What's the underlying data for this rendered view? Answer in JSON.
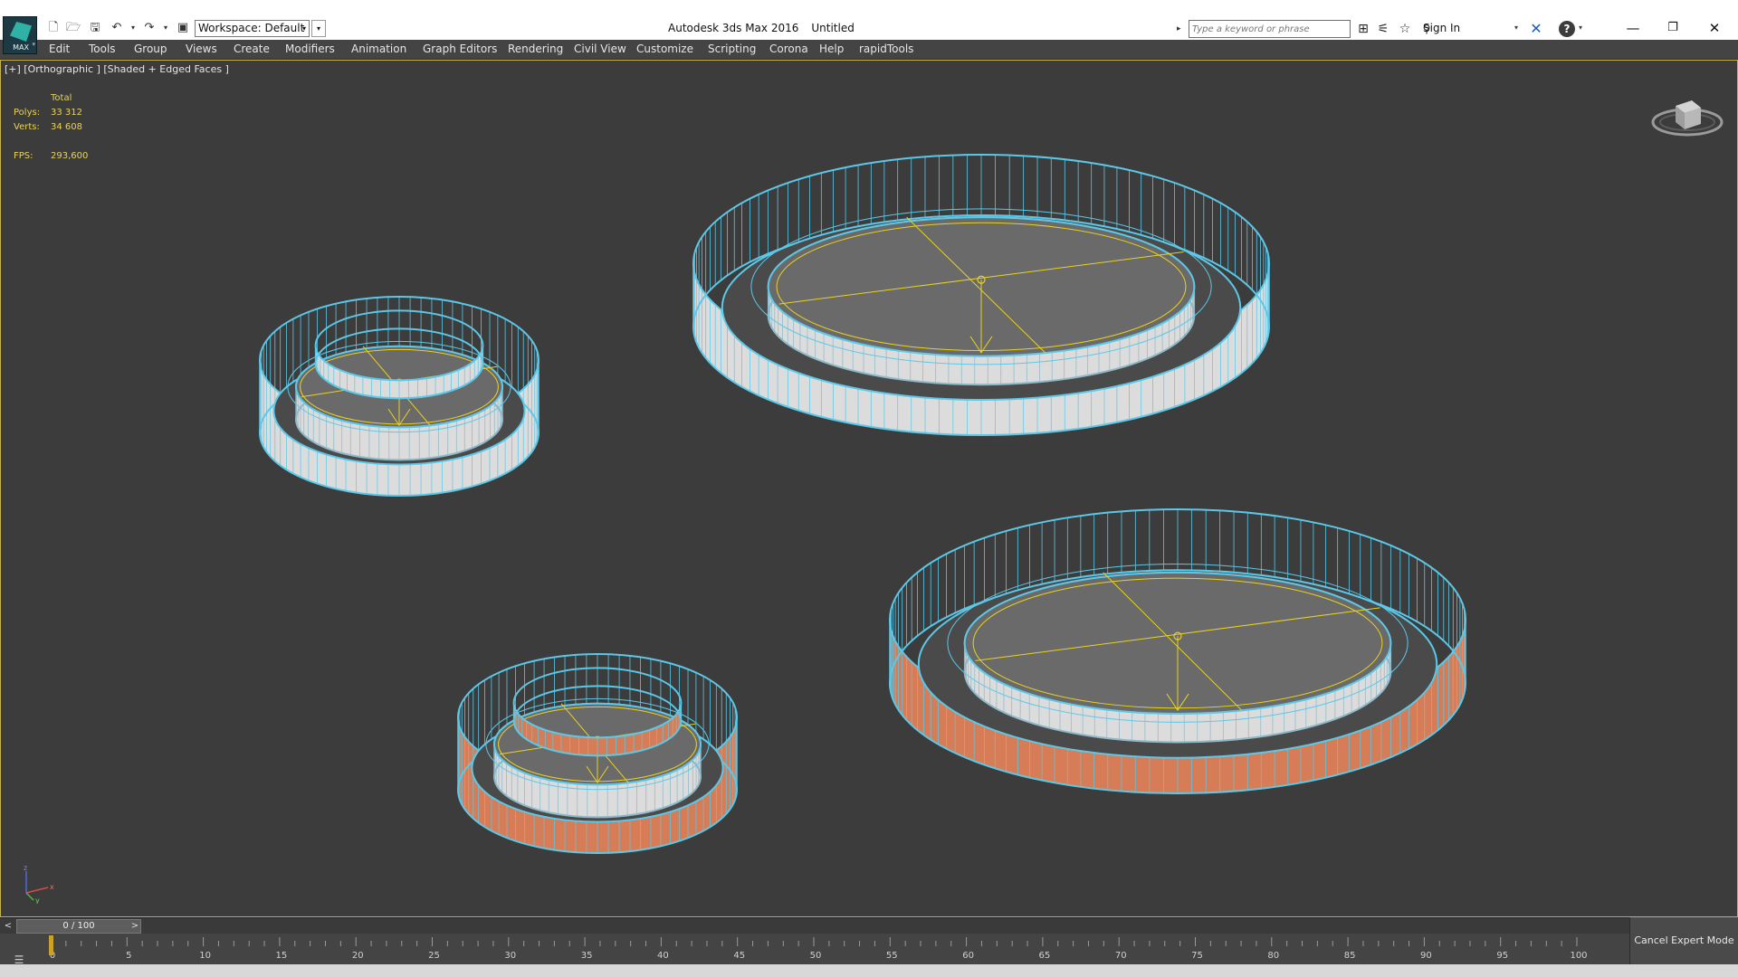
{
  "app": {
    "logo_text": "MAX",
    "title": "Autodesk 3ds Max 2016",
    "document": "Untitled",
    "workspace": "Workspace: Default"
  },
  "search": {
    "placeholder": "Type a keyword or phrase"
  },
  "header": {
    "sign_in": "Sign In"
  },
  "icons": {
    "quick_access": [
      "new-file-icon",
      "open-folder-icon",
      "save-icon",
      "undo-icon",
      "redo-icon",
      "project-folder-icon"
    ],
    "info_center": [
      "binoculars-icon",
      "satellite-icon",
      "star-icon",
      "user-icon",
      "autodesk-exchange-icon",
      "help-icon"
    ],
    "window": [
      "minimize-icon",
      "restore-icon",
      "close-icon"
    ]
  },
  "menu": [
    "Edit",
    "Tools",
    "Group",
    "Views",
    "Create",
    "Modifiers",
    "Animation",
    "Graph Editors",
    "Rendering",
    "Civil View",
    "Customize",
    "Scripting",
    "Corona",
    "Help",
    "rapidTools"
  ],
  "viewport": {
    "label": "[+] [Orthographic ] [Shaded + Edged Faces ]",
    "stats": {
      "header": "Total",
      "polys_label": "Polys:",
      "polys": "33 312",
      "verts_label": "Verts:",
      "verts": "34 608",
      "fps_label": "FPS:",
      "fps": "293,600"
    },
    "colors": {
      "background": "#3c3c3c",
      "selection_wire": "#5cc8e8",
      "gizmo": "#e8d320",
      "white_material": "#dcdcdc",
      "orange_material": "#d67d57",
      "cap_gray": "#6a6a6a"
    },
    "axis": {
      "x": "x",
      "y": "y",
      "z": "z"
    }
  },
  "time_slider": {
    "frame": "0 / 100",
    "prev": "<",
    "next": ">",
    "tick_labels": [
      "0",
      "5",
      "10",
      "15",
      "20",
      "25",
      "30",
      "35",
      "40",
      "45",
      "50",
      "55",
      "60",
      "65",
      "70",
      "75",
      "80",
      "85",
      "90",
      "95",
      "100"
    ]
  },
  "bottom": {
    "cancel_expert_mode": "Cancel Expert Mode"
  }
}
